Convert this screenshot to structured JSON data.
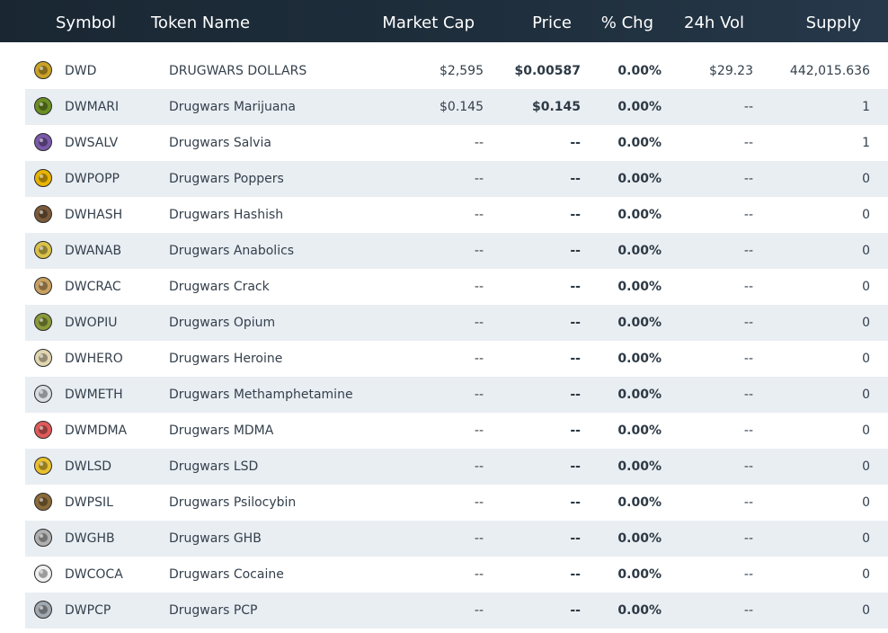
{
  "header": {
    "symbol": "Symbol",
    "token_name": "Token Name",
    "market_cap": "Market Cap",
    "price": "Price",
    "pct_chg": "% Chg",
    "vol_24h": "24h Vol",
    "supply": "Supply"
  },
  "rows": [
    {
      "symbol": "DWD",
      "name": "DRUGWARS DOLLARS",
      "market_cap": "$2,595",
      "price": "$0.00587",
      "chg": "0.00%",
      "vol": "$29.23",
      "supply": "442,015.636",
      "icon": "dwd-coin-icon",
      "icon_color": "#c9a227"
    },
    {
      "symbol": "DWMARI",
      "name": "Drugwars Marijuana",
      "market_cap": "$0.145",
      "price": "$0.145",
      "chg": "0.00%",
      "vol": "--",
      "supply": "1",
      "icon": "marijuana-leaf-icon",
      "icon_color": "#6b8e23"
    },
    {
      "symbol": "DWSALV",
      "name": "Drugwars Salvia",
      "market_cap": "--",
      "price": "--",
      "chg": "0.00%",
      "vol": "--",
      "supply": "1",
      "icon": "salvia-plant-icon",
      "icon_color": "#7a5aa8"
    },
    {
      "symbol": "DWPOPP",
      "name": "Drugwars Poppers",
      "market_cap": "--",
      "price": "--",
      "chg": "0.00%",
      "vol": "--",
      "supply": "0",
      "icon": "poppers-bottle-icon",
      "icon_color": "#e8b400"
    },
    {
      "symbol": "DWHASH",
      "name": "Drugwars Hashish",
      "market_cap": "--",
      "price": "--",
      "chg": "0.00%",
      "vol": "--",
      "supply": "0",
      "icon": "hashish-block-icon",
      "icon_color": "#7a5a3a"
    },
    {
      "symbol": "DWANAB",
      "name": "Drugwars Anabolics",
      "market_cap": "--",
      "price": "--",
      "chg": "0.00%",
      "vol": "--",
      "supply": "0",
      "icon": "anabolics-vial-icon",
      "icon_color": "#d9c24a"
    },
    {
      "symbol": "DWCRAC",
      "name": "Drugwars Crack",
      "market_cap": "--",
      "price": "--",
      "chg": "0.00%",
      "vol": "--",
      "supply": "0",
      "icon": "crack-rock-icon",
      "icon_color": "#c8a060"
    },
    {
      "symbol": "DWOPIU",
      "name": "Drugwars Opium",
      "market_cap": "--",
      "price": "--",
      "chg": "0.00%",
      "vol": "--",
      "supply": "0",
      "icon": "opium-pod-icon",
      "icon_color": "#8a9a3a"
    },
    {
      "symbol": "DWHERO",
      "name": "Drugwars Heroine",
      "market_cap": "--",
      "price": "--",
      "chg": "0.00%",
      "vol": "--",
      "supply": "0",
      "icon": "heroine-powder-icon",
      "icon_color": "#e0d6b0"
    },
    {
      "symbol": "DWMETH",
      "name": "Drugwars Methamphetamine",
      "market_cap": "--",
      "price": "--",
      "chg": "0.00%",
      "vol": "--",
      "supply": "0",
      "icon": "meth-crystal-icon",
      "icon_color": "#d8dde3"
    },
    {
      "symbol": "DWMDMA",
      "name": "Drugwars MDMA",
      "market_cap": "--",
      "price": "--",
      "chg": "0.00%",
      "vol": "--",
      "supply": "0",
      "icon": "mdma-pills-icon",
      "icon_color": "#e05a5a"
    },
    {
      "symbol": "DWLSD",
      "name": "Drugwars LSD",
      "market_cap": "--",
      "price": "--",
      "chg": "0.00%",
      "vol": "--",
      "supply": "0",
      "icon": "lsd-tab-icon",
      "icon_color": "#e8c030"
    },
    {
      "symbol": "DWPSIL",
      "name": "Drugwars Psilocybin",
      "market_cap": "--",
      "price": "--",
      "chg": "0.00%",
      "vol": "--",
      "supply": "0",
      "icon": "psilocybin-mushroom-icon",
      "icon_color": "#8a6a3a"
    },
    {
      "symbol": "DWGHB",
      "name": "Drugwars GHB",
      "market_cap": "--",
      "price": "--",
      "chg": "0.00%",
      "vol": "--",
      "supply": "0",
      "icon": "ghb-bottle-icon",
      "icon_color": "#b0b0b0"
    },
    {
      "symbol": "DWCOCA",
      "name": "Drugwars Cocaine",
      "market_cap": "--",
      "price": "--",
      "chg": "0.00%",
      "vol": "--",
      "supply": "0",
      "icon": "cocaine-powder-icon",
      "icon_color": "#f0f0f0"
    },
    {
      "symbol": "DWPCP",
      "name": "Drugwars PCP",
      "market_cap": "--",
      "price": "--",
      "chg": "0.00%",
      "vol": "--",
      "supply": "0",
      "icon": "pcp-syringe-icon",
      "icon_color": "#a0a8b0"
    }
  ]
}
